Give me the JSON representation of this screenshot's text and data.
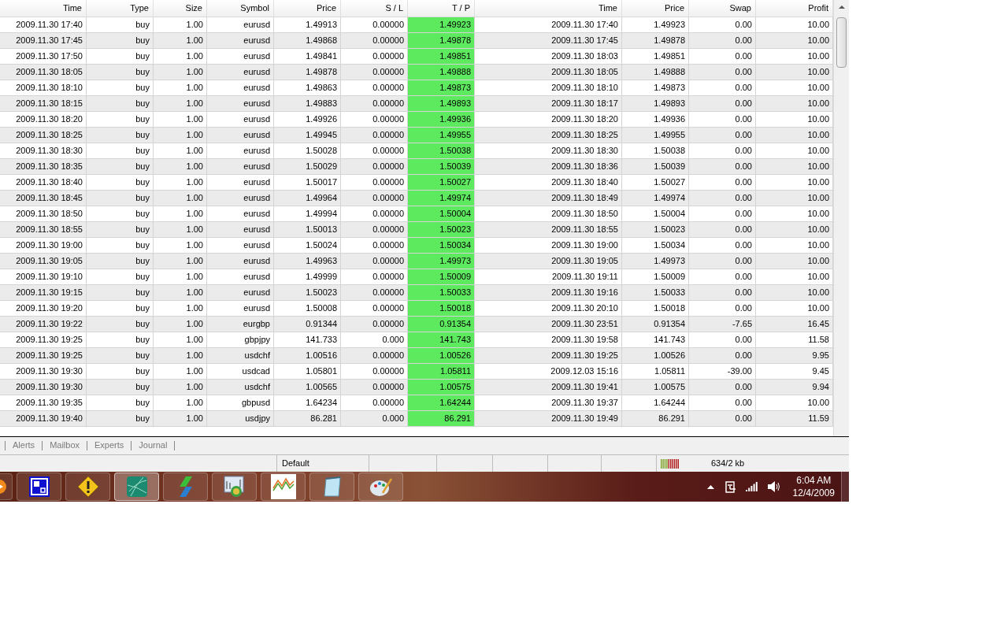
{
  "table": {
    "columns": [
      "Time",
      "Type",
      "Size",
      "Symbol",
      "Price",
      "S / L",
      "T / P",
      "Time",
      "Price",
      "Swap",
      "Profit"
    ],
    "rows": [
      {
        "cells": [
          "2009.11.30 17:40",
          "buy",
          "1.00",
          "eurusd",
          "1.49913",
          "0.00000",
          "1.49923",
          "2009.11.30 17:40",
          "1.49923",
          "0.00",
          "10.00"
        ]
      },
      {
        "cells": [
          "2009.11.30 17:45",
          "buy",
          "1.00",
          "eurusd",
          "1.49868",
          "0.00000",
          "1.49878",
          "2009.11.30 17:45",
          "1.49878",
          "0.00",
          "10.00"
        ]
      },
      {
        "cells": [
          "2009.11.30 17:50",
          "buy",
          "1.00",
          "eurusd",
          "1.49841",
          "0.00000",
          "1.49851",
          "2009.11.30 18:03",
          "1.49851",
          "0.00",
          "10.00"
        ]
      },
      {
        "cells": [
          "2009.11.30 18:05",
          "buy",
          "1.00",
          "eurusd",
          "1.49878",
          "0.00000",
          "1.49888",
          "2009.11.30 18:05",
          "1.49888",
          "0.00",
          "10.00"
        ]
      },
      {
        "cells": [
          "2009.11.30 18:10",
          "buy",
          "1.00",
          "eurusd",
          "1.49863",
          "0.00000",
          "1.49873",
          "2009.11.30 18:10",
          "1.49873",
          "0.00",
          "10.00"
        ]
      },
      {
        "cells": [
          "2009.11.30 18:15",
          "buy",
          "1.00",
          "eurusd",
          "1.49883",
          "0.00000",
          "1.49893",
          "2009.11.30 18:17",
          "1.49893",
          "0.00",
          "10.00"
        ]
      },
      {
        "cells": [
          "2009.11.30 18:20",
          "buy",
          "1.00",
          "eurusd",
          "1.49926",
          "0.00000",
          "1.49936",
          "2009.11.30 18:20",
          "1.49936",
          "0.00",
          "10.00"
        ]
      },
      {
        "cells": [
          "2009.11.30 18:25",
          "buy",
          "1.00",
          "eurusd",
          "1.49945",
          "0.00000",
          "1.49955",
          "2009.11.30 18:25",
          "1.49955",
          "0.00",
          "10.00"
        ]
      },
      {
        "cells": [
          "2009.11.30 18:30",
          "buy",
          "1.00",
          "eurusd",
          "1.50028",
          "0.00000",
          "1.50038",
          "2009.11.30 18:30",
          "1.50038",
          "0.00",
          "10.00"
        ]
      },
      {
        "cells": [
          "2009.11.30 18:35",
          "buy",
          "1.00",
          "eurusd",
          "1.50029",
          "0.00000",
          "1.50039",
          "2009.11.30 18:36",
          "1.50039",
          "0.00",
          "10.00"
        ]
      },
      {
        "cells": [
          "2009.11.30 18:40",
          "buy",
          "1.00",
          "eurusd",
          "1.50017",
          "0.00000",
          "1.50027",
          "2009.11.30 18:40",
          "1.50027",
          "0.00",
          "10.00"
        ]
      },
      {
        "cells": [
          "2009.11.30 18:45",
          "buy",
          "1.00",
          "eurusd",
          "1.49964",
          "0.00000",
          "1.49974",
          "2009.11.30 18:49",
          "1.49974",
          "0.00",
          "10.00"
        ]
      },
      {
        "cells": [
          "2009.11.30 18:50",
          "buy",
          "1.00",
          "eurusd",
          "1.49994",
          "0.00000",
          "1.50004",
          "2009.11.30 18:50",
          "1.50004",
          "0.00",
          "10.00"
        ]
      },
      {
        "cells": [
          "2009.11.30 18:55",
          "buy",
          "1.00",
          "eurusd",
          "1.50013",
          "0.00000",
          "1.50023",
          "2009.11.30 18:55",
          "1.50023",
          "0.00",
          "10.00"
        ]
      },
      {
        "cells": [
          "2009.11.30 19:00",
          "buy",
          "1.00",
          "eurusd",
          "1.50024",
          "0.00000",
          "1.50034",
          "2009.11.30 19:00",
          "1.50034",
          "0.00",
          "10.00"
        ]
      },
      {
        "cells": [
          "2009.11.30 19:05",
          "buy",
          "1.00",
          "eurusd",
          "1.49963",
          "0.00000",
          "1.49973",
          "2009.11.30 19:05",
          "1.49973",
          "0.00",
          "10.00"
        ]
      },
      {
        "cells": [
          "2009.11.30 19:10",
          "buy",
          "1.00",
          "eurusd",
          "1.49999",
          "0.00000",
          "1.50009",
          "2009.11.30 19:11",
          "1.50009",
          "0.00",
          "10.00"
        ]
      },
      {
        "cells": [
          "2009.11.30 19:15",
          "buy",
          "1.00",
          "eurusd",
          "1.50023",
          "0.00000",
          "1.50033",
          "2009.11.30 19:16",
          "1.50033",
          "0.00",
          "10.00"
        ]
      },
      {
        "cells": [
          "2009.11.30 19:20",
          "buy",
          "1.00",
          "eurusd",
          "1.50008",
          "0.00000",
          "1.50018",
          "2009.11.30 20:10",
          "1.50018",
          "0.00",
          "10.00"
        ]
      },
      {
        "cells": [
          "2009.11.30 19:22",
          "buy",
          "1.00",
          "eurgbp",
          "0.91344",
          "0.00000",
          "0.91354",
          "2009.11.30 23:51",
          "0.91354",
          "-7.65",
          "16.45"
        ]
      },
      {
        "cells": [
          "2009.11.30 19:25",
          "buy",
          "1.00",
          "gbpjpy",
          "141.733",
          "0.000",
          "141.743",
          "2009.11.30 19:58",
          "141.743",
          "0.00",
          "11.58"
        ]
      },
      {
        "cells": [
          "2009.11.30 19:25",
          "buy",
          "1.00",
          "usdchf",
          "1.00516",
          "0.00000",
          "1.00526",
          "2009.11.30 19:25",
          "1.00526",
          "0.00",
          "9.95"
        ]
      },
      {
        "cells": [
          "2009.11.30 19:30",
          "buy",
          "1.00",
          "usdcad",
          "1.05801",
          "0.00000",
          "1.05811",
          "2009.12.03 15:16",
          "1.05811",
          "-39.00",
          "9.45"
        ]
      },
      {
        "cells": [
          "2009.11.30 19:30",
          "buy",
          "1.00",
          "usdchf",
          "1.00565",
          "0.00000",
          "1.00575",
          "2009.11.30 19:41",
          "1.00575",
          "0.00",
          "9.94"
        ]
      },
      {
        "cells": [
          "2009.11.30 19:35",
          "buy",
          "1.00",
          "gbpusd",
          "1.64234",
          "0.00000",
          "1.64244",
          "2009.11.30 19:37",
          "1.64244",
          "0.00",
          "10.00"
        ]
      },
      {
        "cells": [
          "2009.11.30 19:40",
          "buy",
          "1.00",
          "usdjpy",
          "86.281",
          "0.000",
          "86.291",
          "2009.11.30 19:49",
          "86.291",
          "0.00",
          "11.59"
        ]
      }
    ]
  },
  "tabs": [
    "Alerts",
    "Mailbox",
    "Experts",
    "Journal"
  ],
  "status_bar": {
    "profile": "Default",
    "traffic": "634/2 kb"
  },
  "taskbar": {
    "time": "6:04 AM",
    "date": "12/4/2009"
  }
}
